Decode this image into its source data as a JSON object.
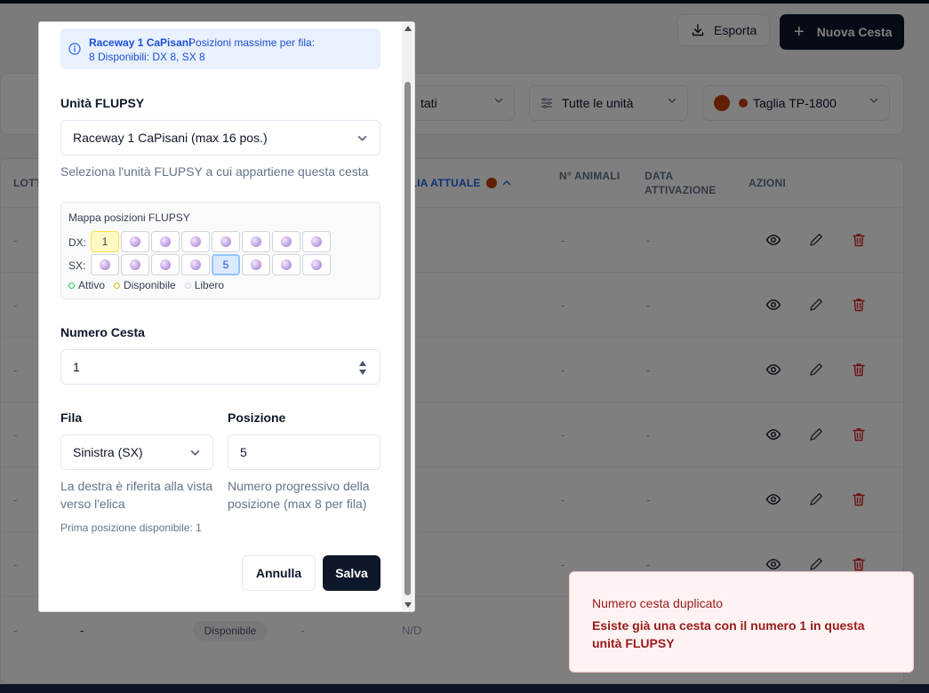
{
  "toolbar": {
    "export_label": "Esporta",
    "new_label": "Nuova Cesta"
  },
  "filters": {
    "state_partial": "tati",
    "units_label": "Tutte le unità",
    "size_label": "Taglia TP-1800"
  },
  "table": {
    "headers": {
      "lotto": "LOTT",
      "size": "GLIA ATTUALE",
      "animals": "N° ANIMALI",
      "activation": "DATA ATTIVAZIONE",
      "actions": "AZIONI"
    },
    "dash": "-",
    "last_row": {
      "dash": "-",
      "badge": "Disponibile",
      "nd": "N/D"
    }
  },
  "modal": {
    "info": {
      "unit_name": "Raceway 1 CaPisani",
      "text_1": "Posizioni massime per fila:",
      "text_2": "8  Disponibili: DX 8, SX 8"
    },
    "unit_label": "Unità FLUPSY",
    "unit_value": "Raceway 1 CaPisani (max 16 pos.)",
    "unit_help": "Seleziona l'unità FLUPSY a cui appartiene questa cesta",
    "map": {
      "title": "Mappa posizioni FLUPSY",
      "dx_label": "DX:",
      "sx_label": "SX:",
      "dx_available_number": "1",
      "sx_selected_number": "5",
      "legend_active": "Attivo",
      "legend_available": "Disponibile",
      "legend_free": "Libero"
    },
    "number_label": "Numero Cesta",
    "number_value": "1",
    "row_label": "Fila",
    "row_value": "Sinistra (SX)",
    "position_label": "Posizione",
    "position_value": "5",
    "row_help": "La destra è riferita alla vista verso l'elica",
    "position_help": "Numero progressivo della posizione (max 8 per fila)",
    "first_available": "Prima posizione disponibile: 1",
    "cancel_label": "Annulla",
    "save_label": "Salva"
  },
  "toast": {
    "title": "Numero cesta duplicato",
    "description": "Esiste già una cesta con il numero 1 in questa unità FLUPSY"
  },
  "colors": {
    "primary": "#0f172a",
    "info_bg": "#e8f1fd",
    "info_text": "#1d4ed8",
    "error_text": "#991b1b",
    "error_bg": "#fef2f2",
    "size_dot": "#c2410c"
  }
}
